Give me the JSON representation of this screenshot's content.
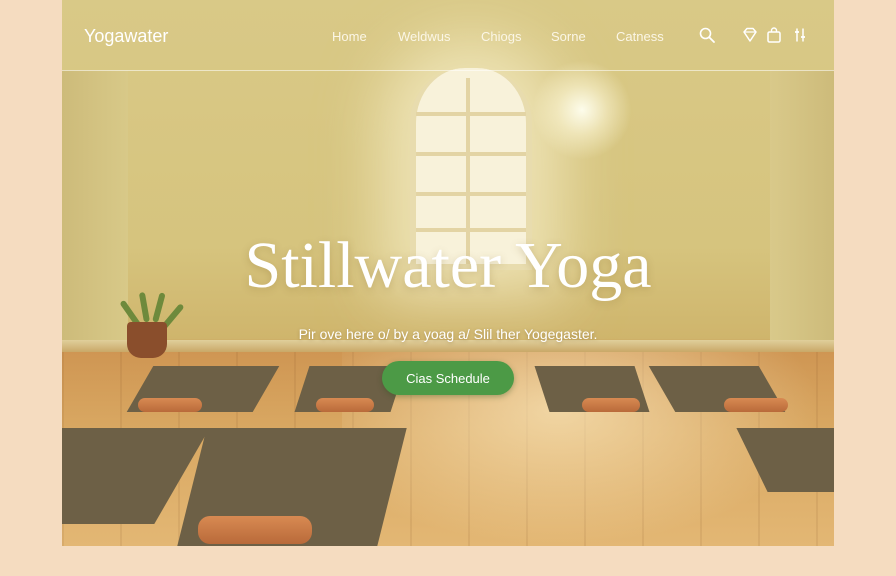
{
  "brand": {
    "name": "Yogawater"
  },
  "nav": {
    "links": [
      "Home",
      "Weldwus",
      "Chiogs",
      "Sorne",
      "Catness"
    ],
    "icons": [
      "search-icon",
      "diamond-icon",
      "bag-icon",
      "sliders-icon"
    ]
  },
  "hero": {
    "title": "Stillwater Yoga",
    "subtitle": "Pir ove here o/ by a yoag a/ Slil ther Yogegaster.",
    "cta_label": "Cias Schedule"
  },
  "colors": {
    "accent": "#4c9a46",
    "page_background": "#f5dcc0",
    "wall": "#d9c987",
    "floor": "#d9a862"
  }
}
